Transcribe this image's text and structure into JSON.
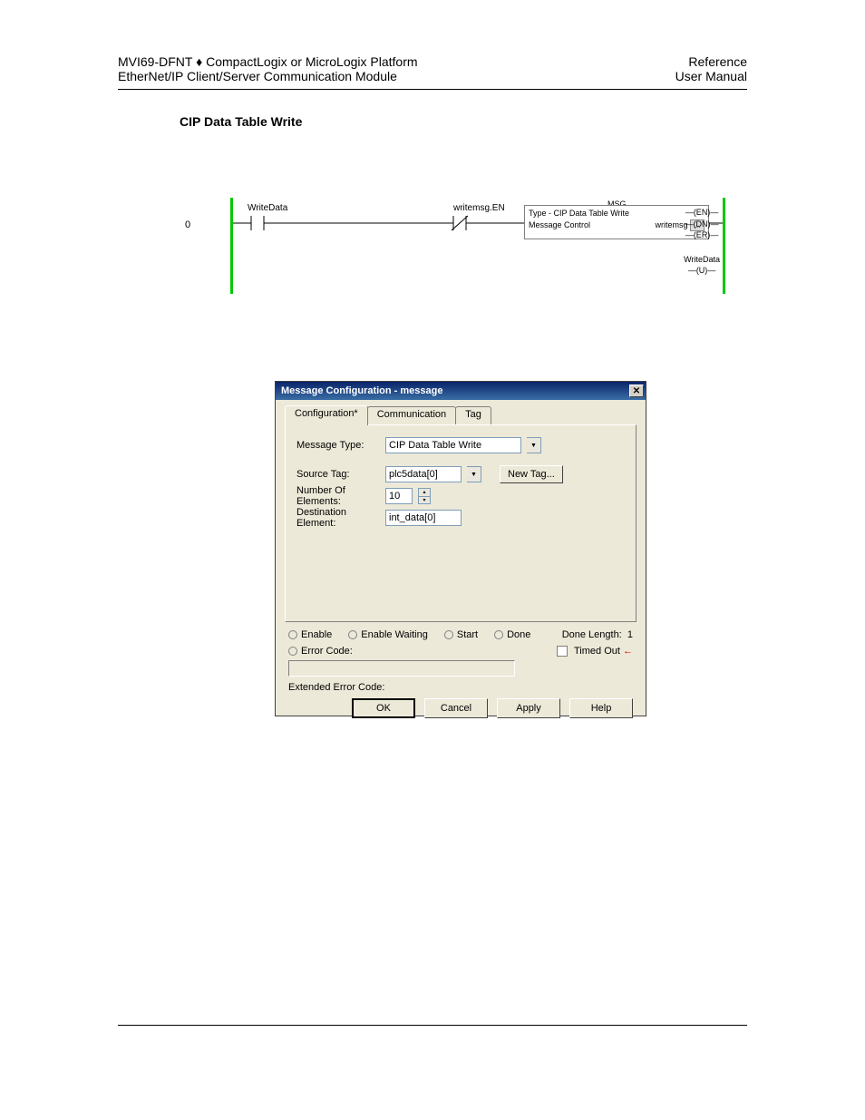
{
  "header": {
    "leftLine1": "MVI69-DFNT ♦ CompactLogix or MicroLogix Platform",
    "leftLine2": "EtherNet/IP Client/Server Communication Module",
    "rightLine1": "Reference",
    "rightLine2": "User Manual"
  },
  "section": {
    "title": "CIP Data Table Write"
  },
  "ladder": {
    "rungNumber": "0",
    "contact1": "WriteData",
    "contact2": "writemsg.EN",
    "msgBox": {
      "title": "MSG",
      "line1Left": "Type - CIP Data Table Write",
      "line2Left": "Message Control",
      "line2Right": "writemsg",
      "ellipsis": "..."
    },
    "coils": {
      "en": "(EN)",
      "dn": "(DN)",
      "er": "(ER)",
      "u": "(U)",
      "uLabel": "WriteData"
    }
  },
  "dialog": {
    "title": "Message Configuration - message",
    "tabs": [
      "Configuration*",
      "Communication",
      "Tag"
    ],
    "activeTab": 0,
    "form": {
      "messageTypeLabel": "Message Type:",
      "messageTypeValue": "CIP Data Table Write",
      "sourceTagLabel": "Source Tag:",
      "sourceTagValue": "plc5data[0]",
      "newTagBtn": "New Tag...",
      "numElLabel": "Number Of Elements:",
      "numElValue": "10",
      "destElLabel": "Destination Element:",
      "destElValue": "int_data[0]"
    },
    "status": {
      "enable": "Enable",
      "enableWaiting": "Enable Waiting",
      "start": "Start",
      "done": "Done",
      "doneLengthLabel": "Done Length:",
      "doneLengthValue": "1",
      "errorCode": "Error Code:",
      "timedOut": "Timed Out",
      "extendedErrorCode": "Extended Error Code:"
    },
    "buttons": {
      "ok": "OK",
      "cancel": "Cancel",
      "apply": "Apply",
      "help": "Help"
    }
  }
}
